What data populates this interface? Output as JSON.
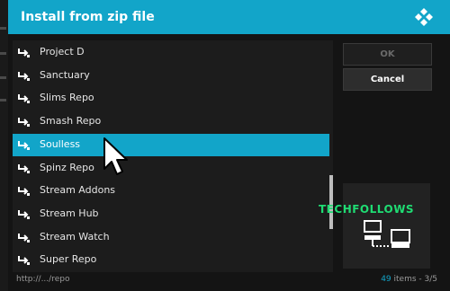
{
  "dialog": {
    "title": "Install from zip file",
    "logo_icon": "kodi-logo-icon"
  },
  "list": {
    "items": [
      {
        "label": "Project D",
        "icon": "folder-return-icon",
        "selected": false
      },
      {
        "label": "Sanctuary",
        "icon": "folder-return-icon",
        "selected": false
      },
      {
        "label": "Slims Repo",
        "icon": "folder-return-icon",
        "selected": false
      },
      {
        "label": "Smash Repo",
        "icon": "folder-return-icon",
        "selected": false
      },
      {
        "label": "Soulless",
        "icon": "folder-return-icon",
        "selected": true
      },
      {
        "label": "Spinz Repo",
        "icon": "folder-return-icon",
        "selected": false
      },
      {
        "label": "Stream Addons",
        "icon": "folder-return-icon",
        "selected": false
      },
      {
        "label": "Stream Hub",
        "icon": "folder-return-icon",
        "selected": false
      },
      {
        "label": "Stream Watch",
        "icon": "folder-return-icon",
        "selected": false
      },
      {
        "label": "Super Repo",
        "icon": "folder-return-icon",
        "selected": false
      }
    ]
  },
  "buttons": {
    "ok_label": "OK",
    "cancel_label": "Cancel"
  },
  "preview": {
    "watermark": "TECHFOLLOWS",
    "icon": "network-drive-icon"
  },
  "footer": {
    "path": "http://.../repo",
    "count_number": "49",
    "count_rest": " items - 3/5"
  },
  "colors": {
    "accent": "#12a5c9",
    "watermark": "#1fdc73"
  }
}
